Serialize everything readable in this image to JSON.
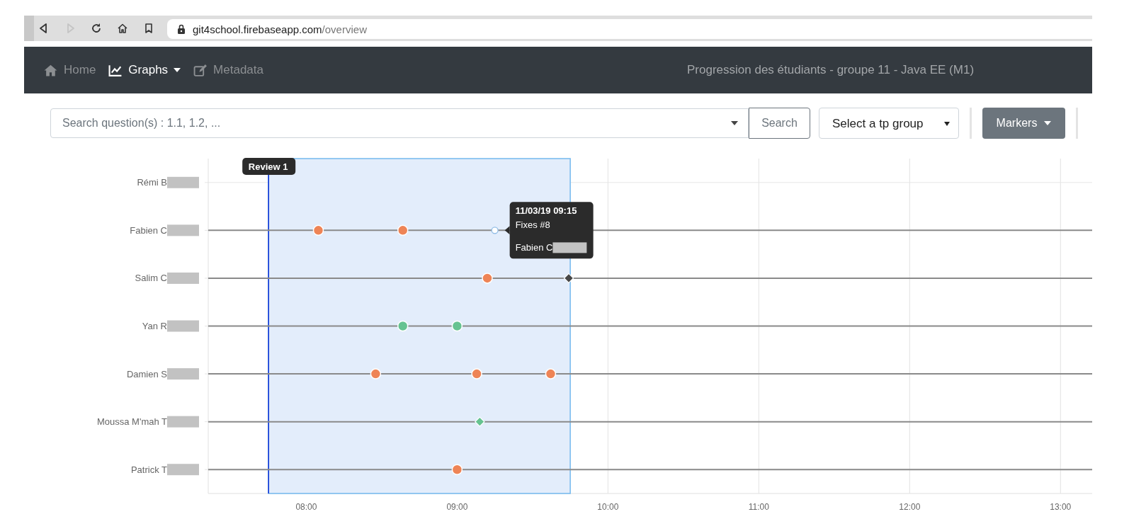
{
  "browser": {
    "url_host": "git4school.firebaseapp.com",
    "url_path": "/overview",
    "forward_disabled": true
  },
  "navbar": {
    "items": [
      {
        "label": "Home",
        "selected": false,
        "dropdown": false
      },
      {
        "label": "Graphs",
        "selected": true,
        "dropdown": true
      },
      {
        "label": "Metadata",
        "selected": false,
        "dropdown": false
      }
    ],
    "title": "Progression des étudiants - groupe 11 - Java EE (M1)"
  },
  "toolbar": {
    "search_placeholder": "Search question(s) : 1.1, 1.2, ...",
    "search_button": "Search",
    "group_select": "Select a tp group",
    "markers_button": "Markers"
  },
  "chart": {
    "chart_data": {
      "type": "scatter",
      "xlim": [
        7.35,
        13.21
      ],
      "orientation": "horizontal",
      "categories": [
        "Rémi B",
        "Fabien C",
        "Salim C",
        "Yan R",
        "Damien S",
        "Moussa M'mah T",
        "Patrick T"
      ],
      "xticks": [
        {
          "value": 8,
          "label": "08:00"
        },
        {
          "value": 9,
          "label": "09:00"
        },
        {
          "value": 10,
          "label": "10:00"
        },
        {
          "value": 11,
          "label": "11:00"
        },
        {
          "value": 12,
          "label": "12:00"
        },
        {
          "value": 13,
          "label": "13:00"
        }
      ],
      "series": [
        {
          "color": "#ee8456",
          "marker": "circle",
          "values": [
            null,
            8.08,
            9.2,
            null,
            8.46,
            null,
            9.0
          ]
        },
        {
          "color": "#ee8456",
          "marker": "circle",
          "values": [
            null,
            8.64,
            null,
            null,
            9.13,
            null,
            null
          ]
        },
        {
          "color": "#ee8456",
          "marker": "circle",
          "values": [
            null,
            null,
            null,
            null,
            9.62,
            null,
            null
          ]
        },
        {
          "color": "#66c391",
          "marker": "circle",
          "values": [
            null,
            null,
            null,
            8.64,
            null,
            null,
            null
          ]
        },
        {
          "color": "#66c391",
          "marker": "circle",
          "values": [
            null,
            null,
            null,
            9.0,
            null,
            null,
            null
          ]
        },
        {
          "color": "#66c391",
          "marker": "diamond",
          "values": [
            null,
            null,
            null,
            null,
            null,
            9.15,
            null
          ]
        },
        {
          "color": "#474747",
          "marker": "diamond",
          "values": [
            null,
            null,
            9.74,
            null,
            null,
            null,
            null
          ]
        },
        {
          "color": "#8fbce6",
          "marker": "circle",
          "values": [
            null,
            9.25,
            null,
            null,
            null,
            null,
            null
          ]
        }
      ],
      "grid": true,
      "bands": [
        {
          "axis": "x",
          "from": 7.75,
          "to": 9.75
        }
      ],
      "ref_lines": [
        {
          "axis": "x",
          "value": 7.75,
          "label": "Review 1"
        }
      ]
    },
    "tooltip": {
      "title": "11/03/19 09:15",
      "text": "Fixes #8",
      "author": "Fabien C"
    }
  }
}
